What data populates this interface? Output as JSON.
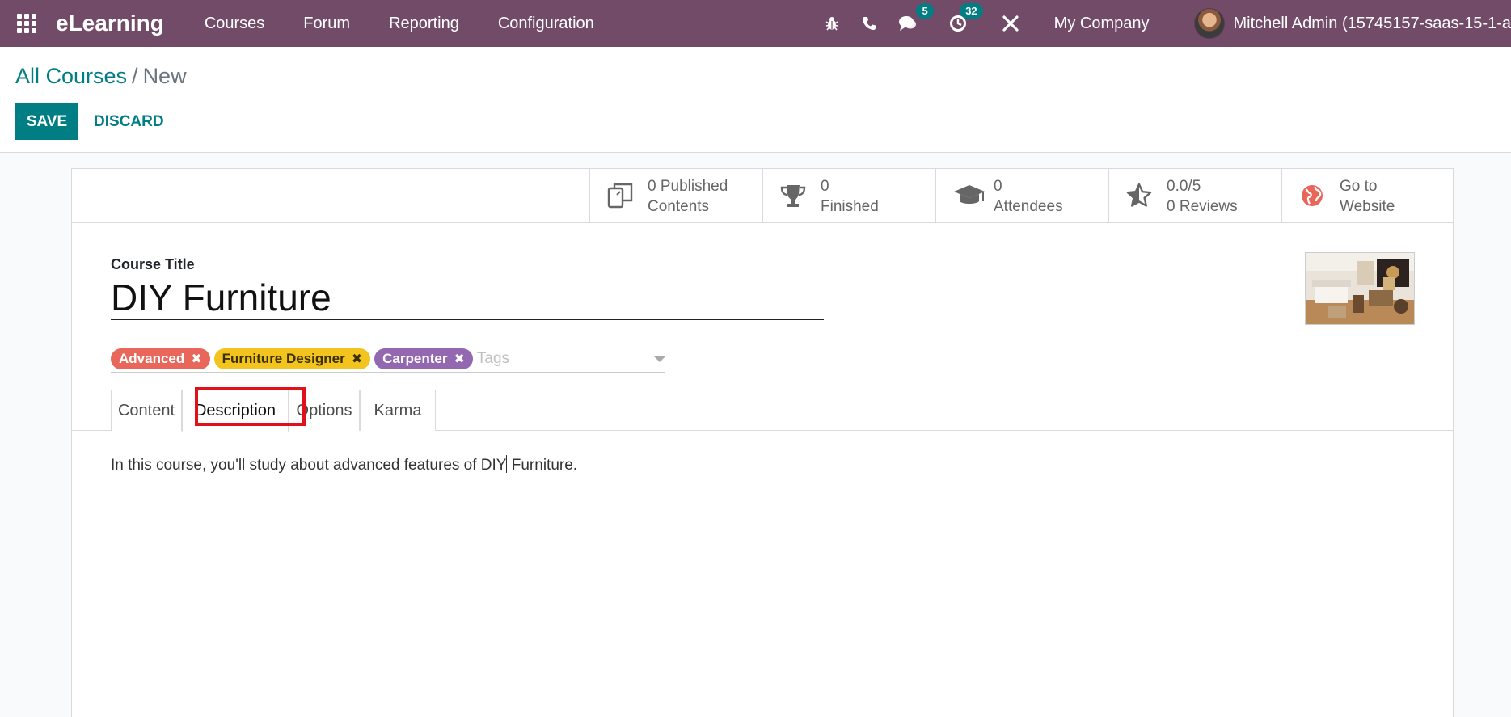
{
  "navbar": {
    "brand": "eLearning",
    "menu": [
      "Courses",
      "Forum",
      "Reporting",
      "Configuration"
    ],
    "messages_badge": "5",
    "activities_badge": "32",
    "company": "My Company",
    "user": "Mitchell Admin (15745157-saas-15-1-a"
  },
  "breadcrumb": {
    "parent": "All Courses",
    "separator": "/",
    "current": "New"
  },
  "actions": {
    "save": "SAVE",
    "discard": "DISCARD"
  },
  "stats": [
    {
      "line1": "0 Published",
      "line2": "Contents",
      "icon": "copy-icon"
    },
    {
      "line1": "0",
      "line2": "Finished",
      "icon": "trophy-icon"
    },
    {
      "line1": "0",
      "line2": "Attendees",
      "icon": "graduation-cap-icon"
    },
    {
      "line1": "0.0/5",
      "line2": "0 Reviews",
      "icon": "star-icon"
    },
    {
      "line1": "Go to",
      "line2": "Website",
      "icon": "globe-icon"
    }
  ],
  "form": {
    "title_label": "Course Title",
    "title_value": "DIY Furniture",
    "tags": [
      {
        "label": "Advanced",
        "color": "#e8665a"
      },
      {
        "label": "Furniture Designer",
        "color": "#f4c41e"
      },
      {
        "label": "Carpenter",
        "color": "#9468b0"
      }
    ],
    "tags_placeholder": "Tags"
  },
  "tabs": [
    "Content",
    "Description",
    "Options",
    "Karma"
  ],
  "active_tab": "Description",
  "description": {
    "before_cursor": "In this course, you'll study about advanced features of DIY",
    "after_cursor": " Furniture."
  },
  "colors": {
    "navbar": "#714b67",
    "primary": "#017e84",
    "highlight": "#e2101b"
  }
}
